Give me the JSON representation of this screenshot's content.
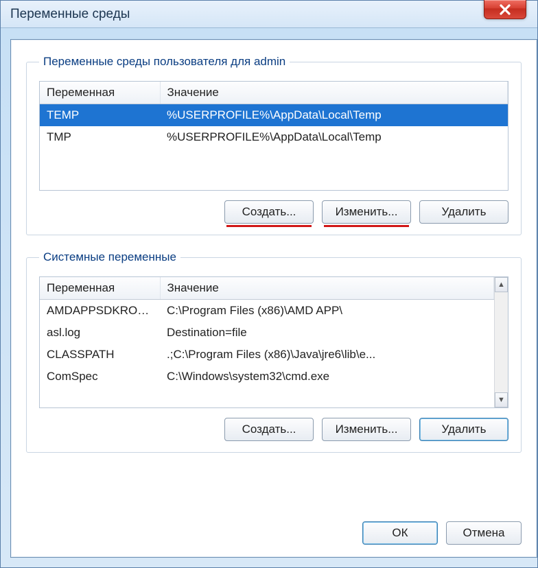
{
  "window": {
    "title": "Переменные среды"
  },
  "user_group": {
    "legend": "Переменные среды пользователя для admin",
    "col_var": "Переменная",
    "col_val": "Значение",
    "rows": [
      {
        "name": "TEMP",
        "value": "%USERPROFILE%\\AppData\\Local\\Temp",
        "selected": true
      },
      {
        "name": "TMP",
        "value": "%USERPROFILE%\\AppData\\Local\\Temp",
        "selected": false
      }
    ],
    "btn_new": "Создать...",
    "btn_edit": "Изменить...",
    "btn_del": "Удалить"
  },
  "sys_group": {
    "legend": "Системные переменные",
    "col_var": "Переменная",
    "col_val": "Значение",
    "rows": [
      {
        "name": "AMDAPPSDKROOT",
        "value": "C:\\Program Files (x86)\\AMD APP\\"
      },
      {
        "name": "asl.log",
        "value": "Destination=file"
      },
      {
        "name": "CLASSPATH",
        "value": ".;C:\\Program Files (x86)\\Java\\jre6\\lib\\e..."
      },
      {
        "name": "ComSpec",
        "value": "C:\\Windows\\system32\\cmd.exe"
      }
    ],
    "btn_new": "Создать...",
    "btn_edit": "Изменить...",
    "btn_del": "Удалить"
  },
  "dialog": {
    "ok": "ОК",
    "cancel": "Отмена"
  }
}
